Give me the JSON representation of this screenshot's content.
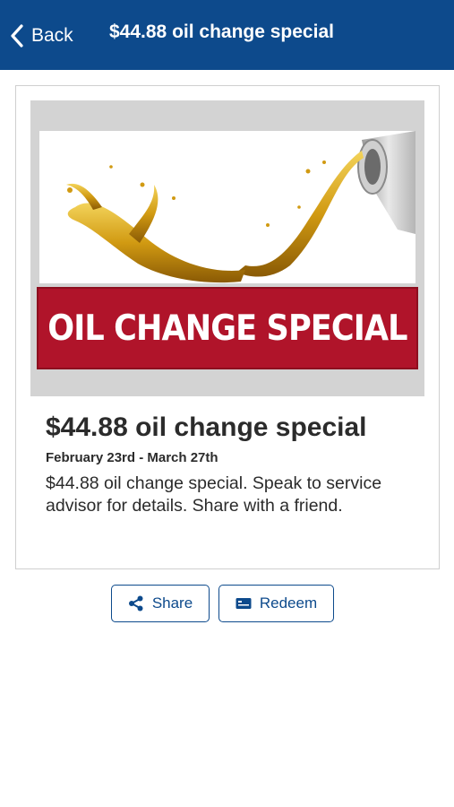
{
  "nav": {
    "back_label": "Back",
    "title": "$44.88 oil change special",
    "background_color": "#0d4a8c",
    "back_icon": "chevron-left-icon"
  },
  "promo_image": {
    "banner_text": "OIL CHANGE SPECIAL",
    "banner_color": "#b0142a"
  },
  "offer": {
    "title": "$44.88 oil change special",
    "dates": "February 23rd - March 27th",
    "description": "$44.88 oil change special. Speak to service advisor for details. Share with a friend."
  },
  "actions": {
    "share_label": "Share",
    "share_icon": "share-icon",
    "redeem_label": "Redeem",
    "redeem_icon": "ticket-icon",
    "accent_color": "#0d4a8c"
  }
}
